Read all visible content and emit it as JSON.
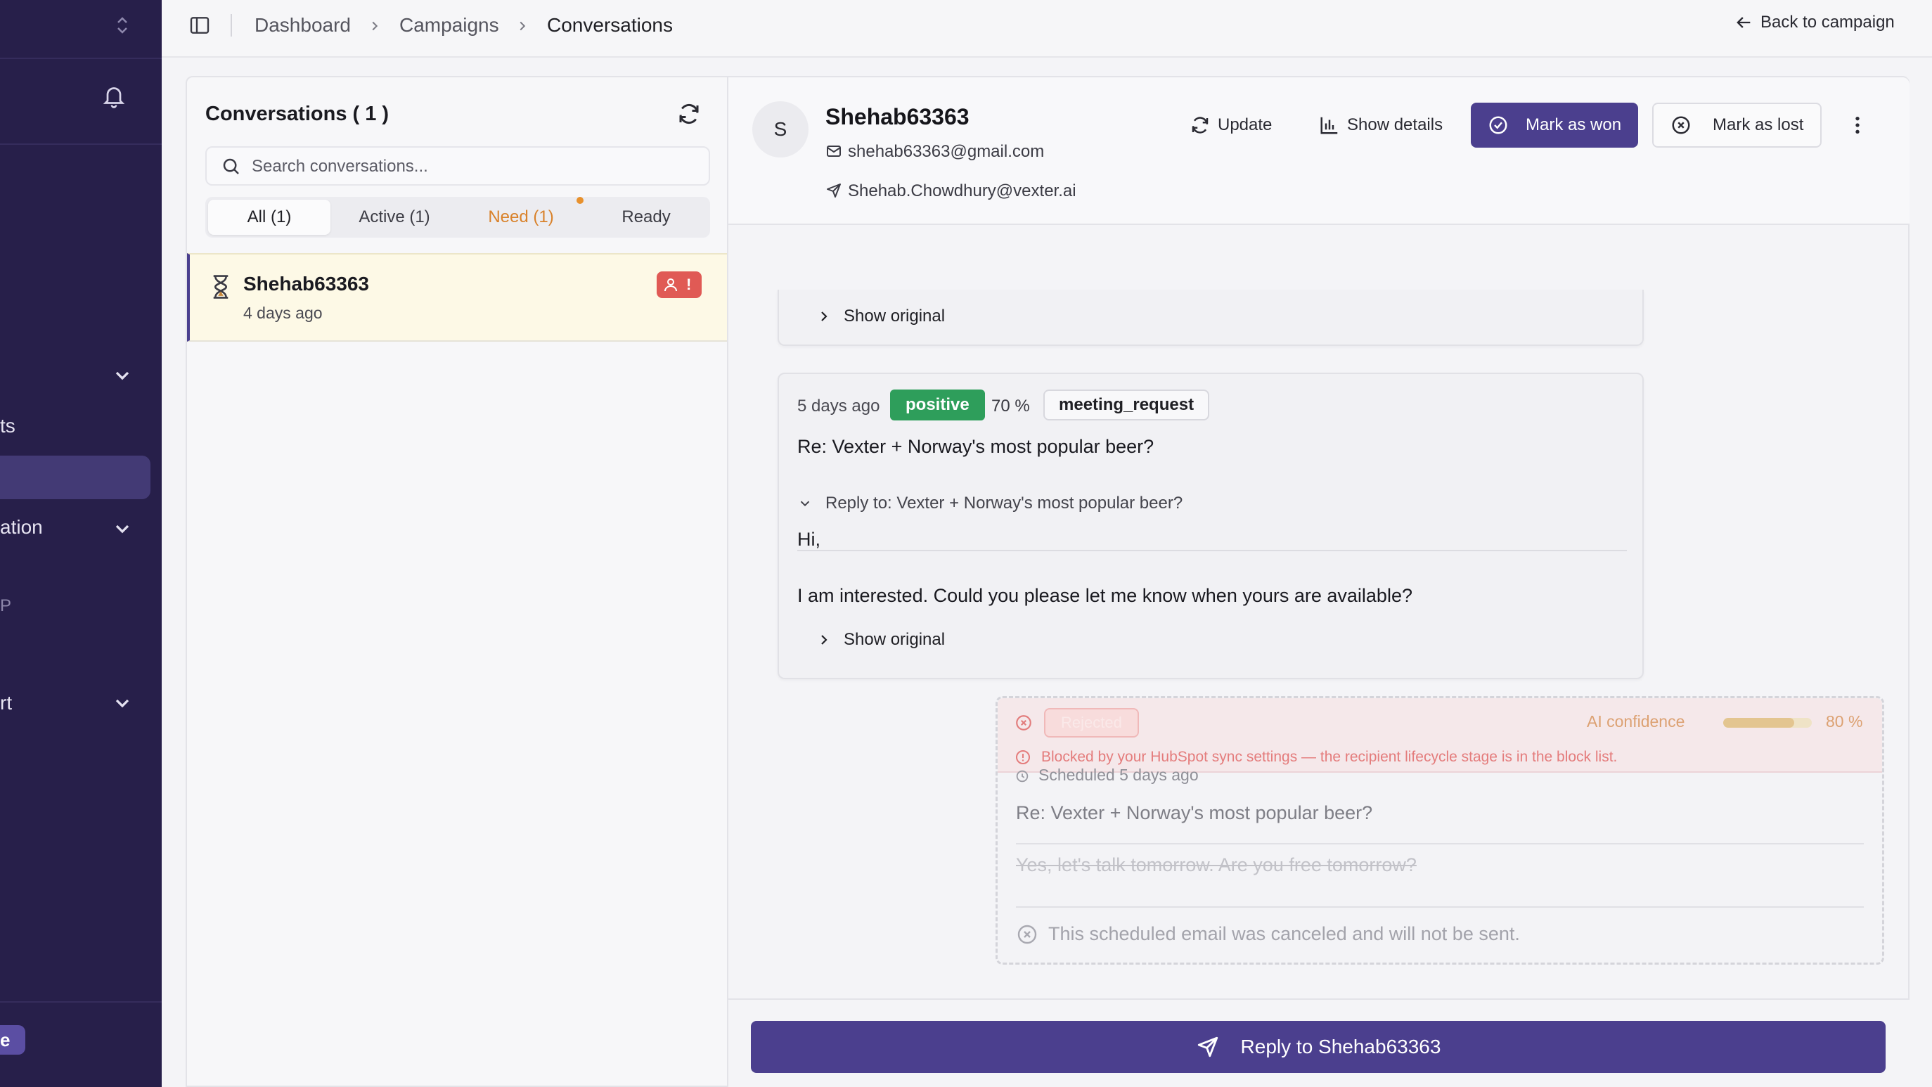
{
  "sidebar": {
    "texts": [
      "ts",
      "ation",
      "P",
      "rt"
    ],
    "badge": "e"
  },
  "breadcrumb": {
    "items": [
      "Dashboard",
      "Campaigns",
      "Conversations"
    ],
    "back_label": "Back to campaign"
  },
  "conversations": {
    "title": "Conversations ( 1 )",
    "search_placeholder": "Search conversations...",
    "tabs": [
      "All (1)",
      "Active (1)",
      "Need (1)",
      "Ready"
    ],
    "items": [
      {
        "name": "Shehab63363",
        "time": "4 days ago",
        "flag": "!"
      }
    ]
  },
  "contact": {
    "initial": "S",
    "name": "Shehab63363",
    "email": "shehab63363@gmail.com",
    "sender": "Shehab.Chowdhury@vexter.ai"
  },
  "actions": {
    "update": "Update",
    "show_details": "Show details",
    "mark_won": "Mark as won",
    "mark_lost": "Mark as lost"
  },
  "thread": {
    "show_original": "Show original",
    "message": {
      "time": "5 days ago",
      "sentiment": "positive",
      "confidence": "70 %",
      "intent": "meeting_request",
      "subject": "Re: Vexter + Norway's most popular beer?",
      "reply_to": "Reply to: Vexter + Norway's most popular beer?",
      "greeting": "Hi,",
      "body": "I am interested. Could you please let me know when yours are available?"
    },
    "scheduled": {
      "tag": "Rejected",
      "ai_label": "AI confidence",
      "ai_value": "80 %",
      "ai_fraction": 0.8,
      "blocked": "Blocked by your HubSpot sync settings — the recipient lifecycle stage is in the block list.",
      "scheduled_time": "Scheduled 5 days ago",
      "subject": "Re: Vexter + Norway's most popular beer?",
      "body": "Yes, let's talk tomorrow. Are you free tomorrow?",
      "canceled": "This scheduled email was canceled and will not be sent."
    }
  },
  "composer": {
    "reply_label": "Reply to Shehab63363"
  },
  "colors": {
    "sidebar": "#271f4a",
    "accent": "#4b3f8e",
    "positive": "#2e9e5b",
    "need": "#d9822b",
    "danger": "#e05a55"
  }
}
